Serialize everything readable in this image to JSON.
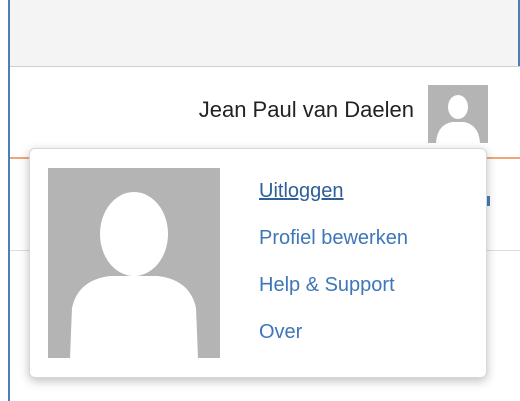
{
  "header": {
    "user_name": "Jean Paul van Daelen"
  },
  "user_menu": {
    "items": [
      {
        "label": "Uitloggen"
      },
      {
        "label": "Profiel bewerken"
      },
      {
        "label": "Help & Support"
      },
      {
        "label": "Over"
      }
    ]
  },
  "colors": {
    "link": "#3e76b8",
    "accent_orange": "#f0a67a",
    "frame_blue": "#4a7fb8",
    "avatar_gray": "#b4b4b4"
  },
  "icons": {
    "avatar": "default-user-avatar-icon"
  }
}
